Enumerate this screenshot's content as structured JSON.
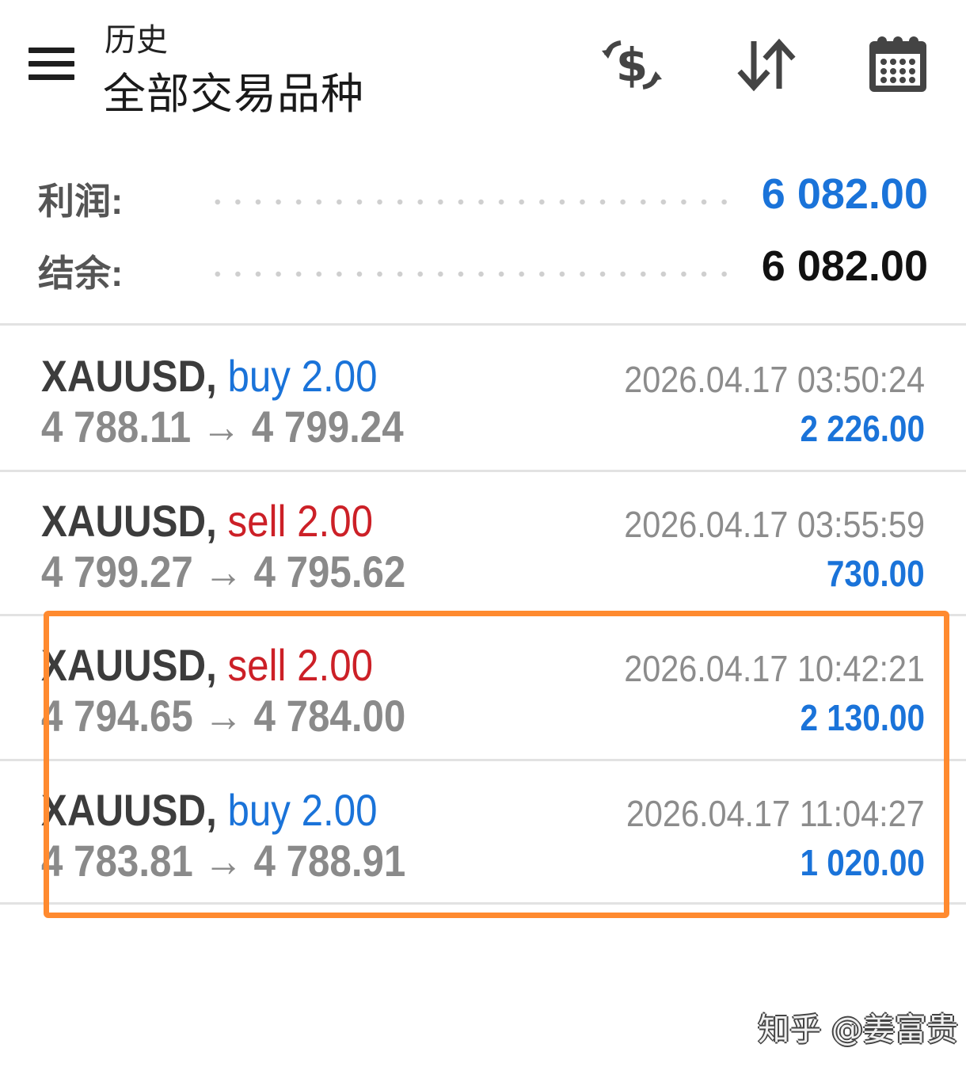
{
  "header": {
    "subtitle": "历史",
    "title": "全部交易品种",
    "icons": [
      "menu-icon",
      "currency-exchange-icon",
      "sort-icon",
      "calendar-icon"
    ]
  },
  "summary": {
    "profit_label": "利润:",
    "profit_value": "6 082.00",
    "balance_label": "结余:",
    "balance_value": "6 082.00"
  },
  "trades": [
    {
      "symbol": "XAUUSD,",
      "side": "buy",
      "volume": "2.00",
      "open": "4 788.11",
      "arrow": "→",
      "close": "4 799.24",
      "time": "2026.04.17 03:50:24",
      "profit": "2 226.00"
    },
    {
      "symbol": "XAUUSD,",
      "side": "sell",
      "volume": "2.00",
      "open": "4 799.27",
      "arrow": "→",
      "close": "4 795.62",
      "time": "2026.04.17 03:55:59",
      "profit": "730.00"
    },
    {
      "symbol": "XAUUSD,",
      "side": "sell",
      "volume": "2.00",
      "open": "4 794.65",
      "arrow": "→",
      "close": "4 784.00",
      "time": "2026.04.17 10:42:21",
      "profit": "2 130.00"
    },
    {
      "symbol": "XAUUSD,",
      "side": "buy",
      "volume": "2.00",
      "open": "4 783.81",
      "arrow": "→",
      "close": "4 788.91",
      "time": "2026.04.17 11:04:27",
      "profit": "1 020.00"
    }
  ],
  "colors": {
    "buy": "#1a73d9",
    "sell": "#cc2027",
    "profit": "#1a73d9",
    "highlight": "#ff8a2f"
  },
  "watermark": "知乎 @姜富贵"
}
